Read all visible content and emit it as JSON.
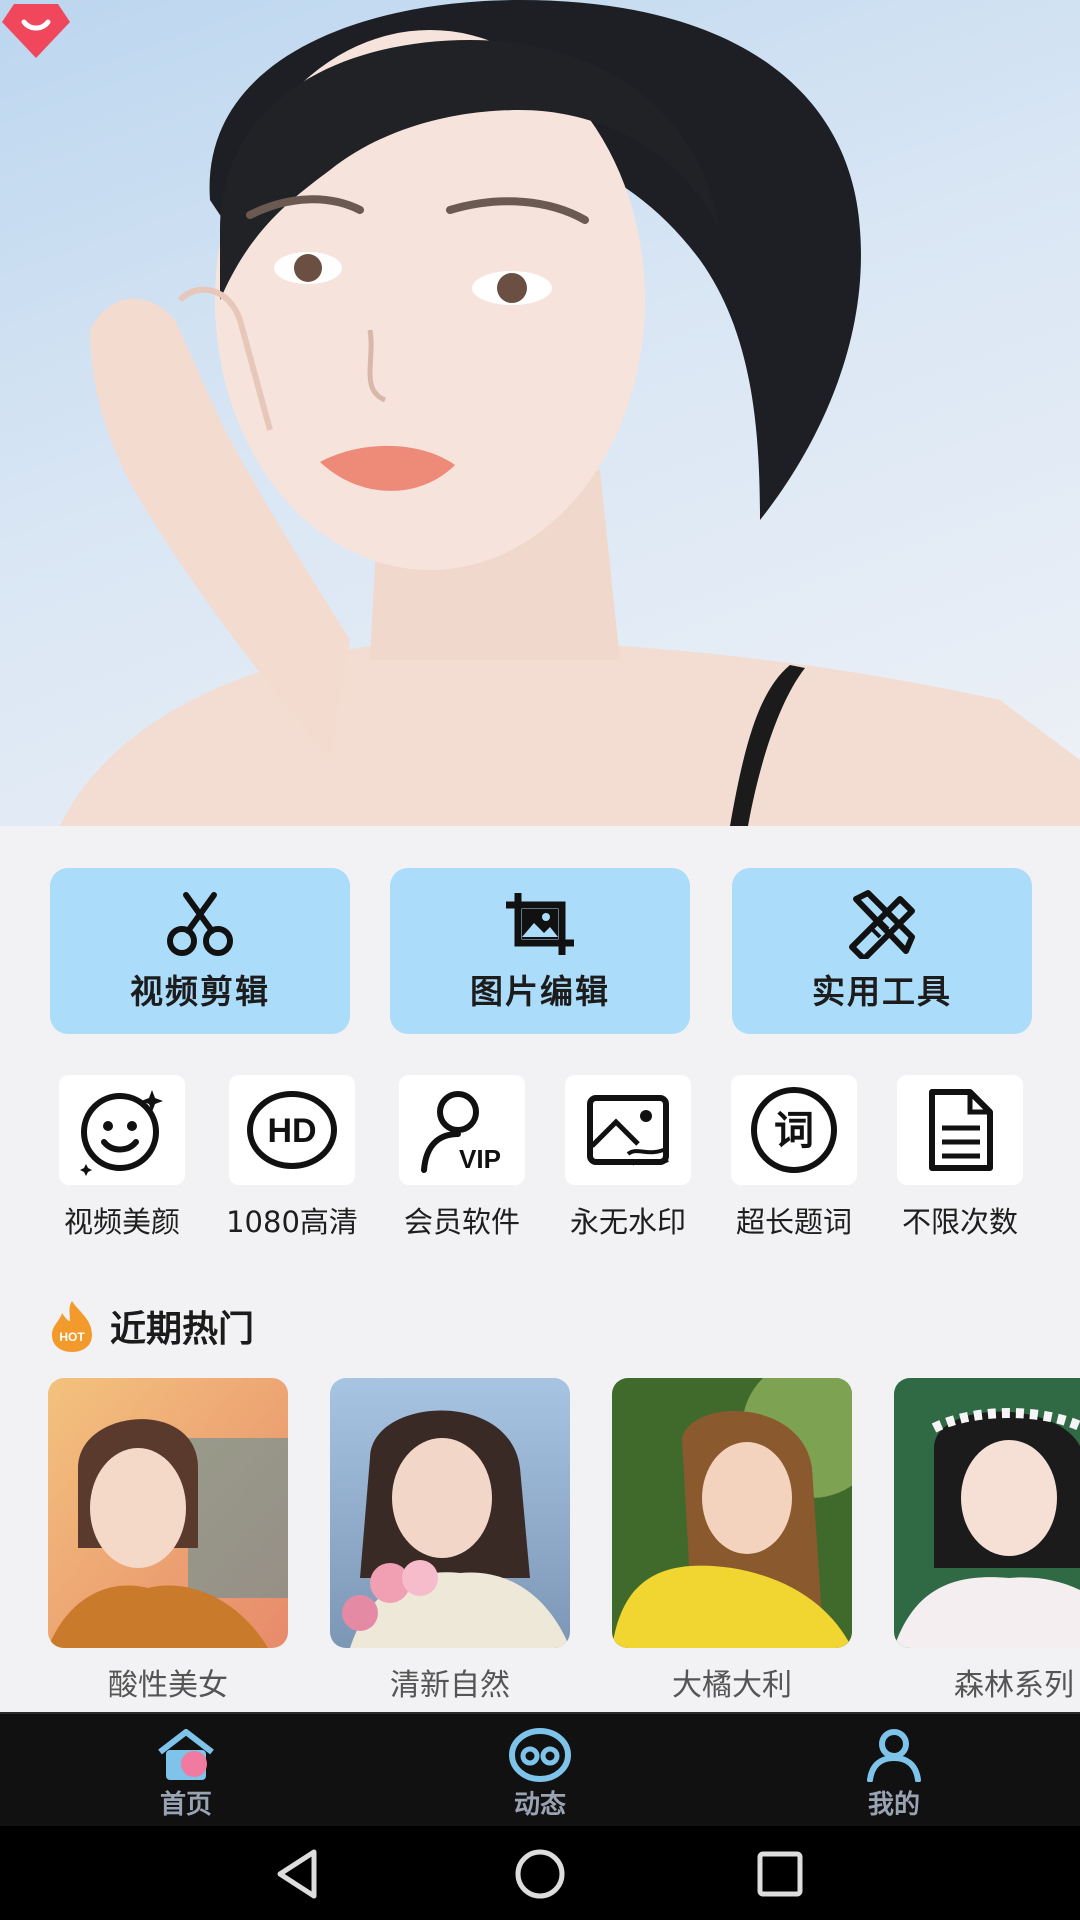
{
  "actions": [
    {
      "label": "视频剪辑",
      "icon": "scissors-icon"
    },
    {
      "label": "图片编辑",
      "icon": "crop-image-icon"
    },
    {
      "label": "实用工具",
      "icon": "tools-icon"
    }
  ],
  "features": [
    {
      "label": "视频美颜",
      "icon": "smile-face-icon"
    },
    {
      "label": "1080高清",
      "icon": "hd-icon"
    },
    {
      "label": "会员软件",
      "icon": "vip-user-icon"
    },
    {
      "label": "永无水印",
      "icon": "image-icon"
    },
    {
      "label": "超长题词",
      "icon": "ci-text-icon"
    },
    {
      "label": "不限次数",
      "icon": "document-icon"
    }
  ],
  "hot": {
    "badge": "HOT",
    "title": "近期热门",
    "cards": [
      {
        "label": "酸性美女"
      },
      {
        "label": "清新自然"
      },
      {
        "label": "大橘大利"
      },
      {
        "label": "森林系列"
      }
    ]
  },
  "hd_icon_text": "HD",
  "vip_icon_text": "VIP",
  "ci_icon_text": "词",
  "tabs": [
    {
      "label": "首页",
      "icon": "home-icon"
    },
    {
      "label": "动态",
      "icon": "activity-icon"
    },
    {
      "label": "我的",
      "icon": "profile-icon"
    }
  ],
  "colors": {
    "action_bg": "#abdcfa",
    "vip_gem": "#f0475c",
    "hot_flame": "#f39a2c",
    "tab_bar": "#111111"
  }
}
